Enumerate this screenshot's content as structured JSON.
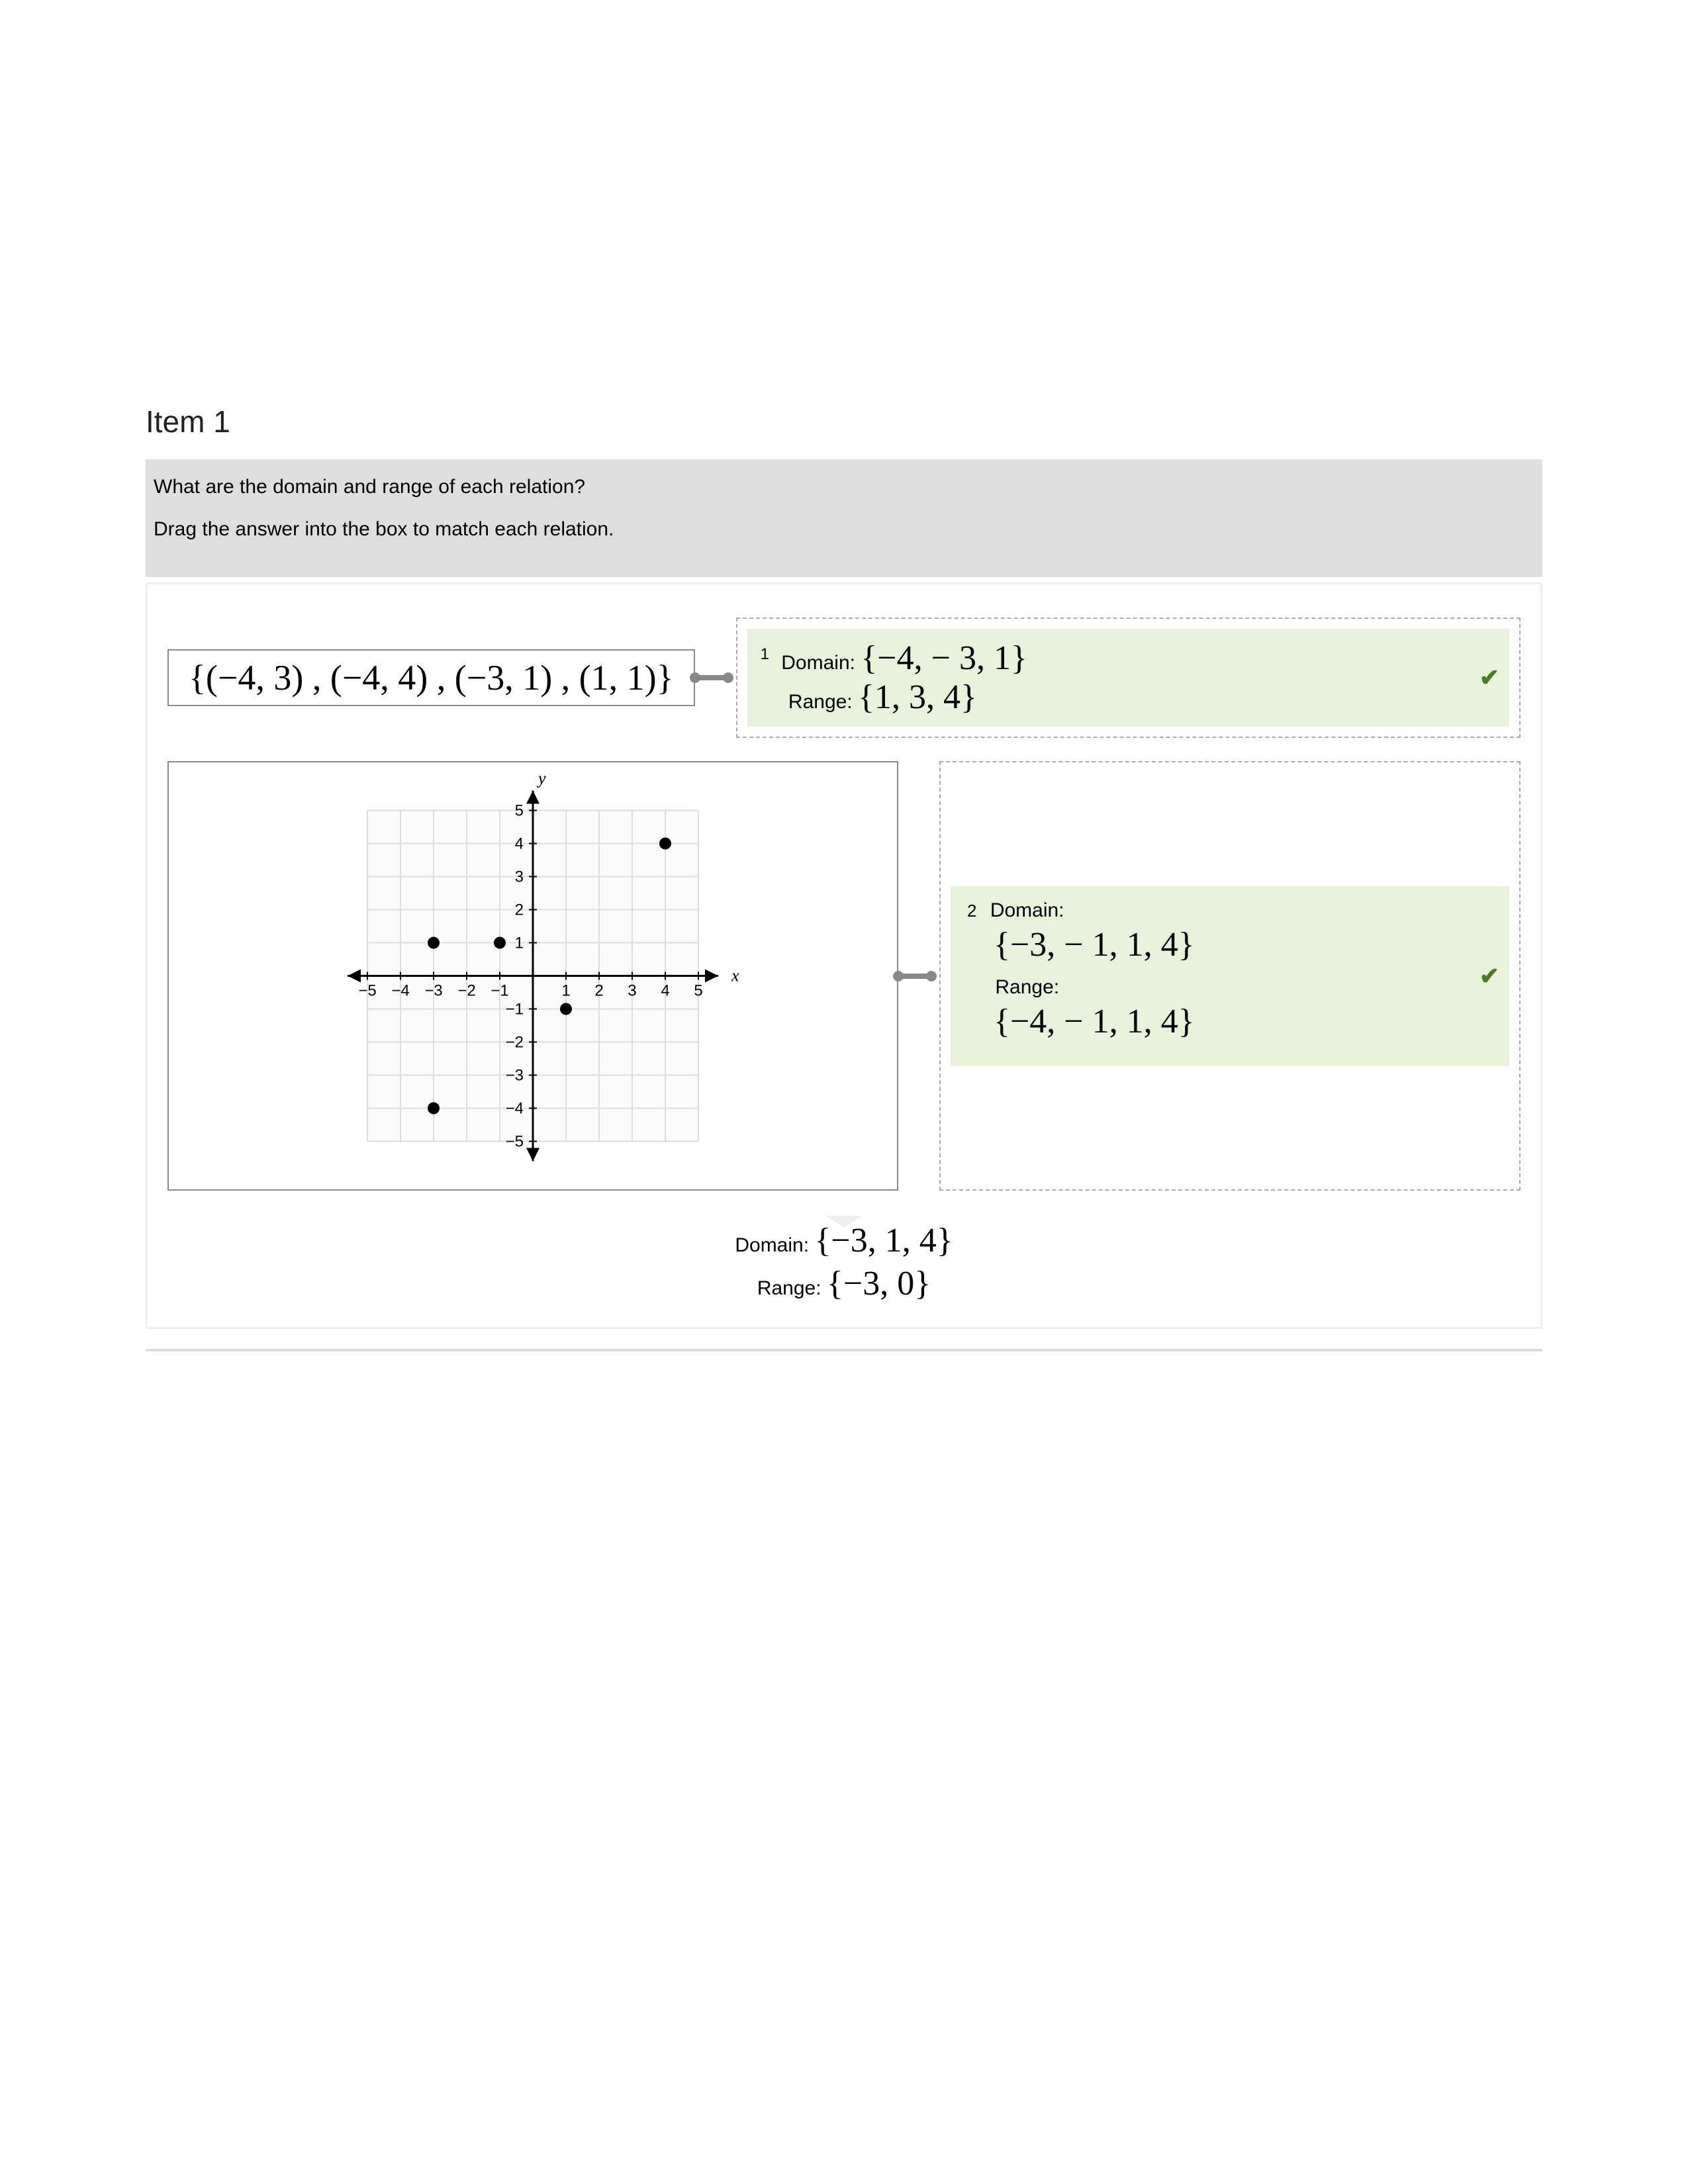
{
  "title": "Item 1",
  "question_line1": "What are the domain and range of each relation?",
  "question_line2": "Drag the answer into the box to match each relation.",
  "relation_set": "{(−4, 3) ,  (−4, 4) ,  (−3, 1) ,  (1, 1)}",
  "answer1": {
    "index": "1",
    "domain_label": "Domain:",
    "domain_set": "{−4,  − 3, 1}",
    "range_label": "Range:",
    "range_set": "{1, 3, 4}",
    "correct": "✔"
  },
  "answer2": {
    "index": "2",
    "domain_label": "Domain:",
    "domain_set": "{−3,  − 1, 1, 4}",
    "range_label": "Range:",
    "range_set": "{−4,  − 1, 1, 4}",
    "correct": "✔"
  },
  "pool": {
    "domain_label": "Domain:",
    "domain_set": "{−3, 1, 4}",
    "range_label": "Range:",
    "range_set": "{−3, 0}"
  },
  "chart_data": {
    "type": "scatter",
    "xlabel": "x",
    "ylabel": "y",
    "xlim": [
      -5,
      5
    ],
    "ylim": [
      -5,
      5
    ],
    "x_ticks": [
      -5,
      -4,
      -3,
      -2,
      -1,
      1,
      2,
      3,
      4,
      5
    ],
    "y_ticks": [
      -5,
      -4,
      -3,
      -2,
      -1,
      1,
      2,
      3,
      4,
      5
    ],
    "points": [
      {
        "x": -3,
        "y": 1
      },
      {
        "x": -1,
        "y": 1
      },
      {
        "x": 1,
        "y": -1
      },
      {
        "x": -3,
        "y": -4
      },
      {
        "x": 4,
        "y": 4
      }
    ]
  }
}
